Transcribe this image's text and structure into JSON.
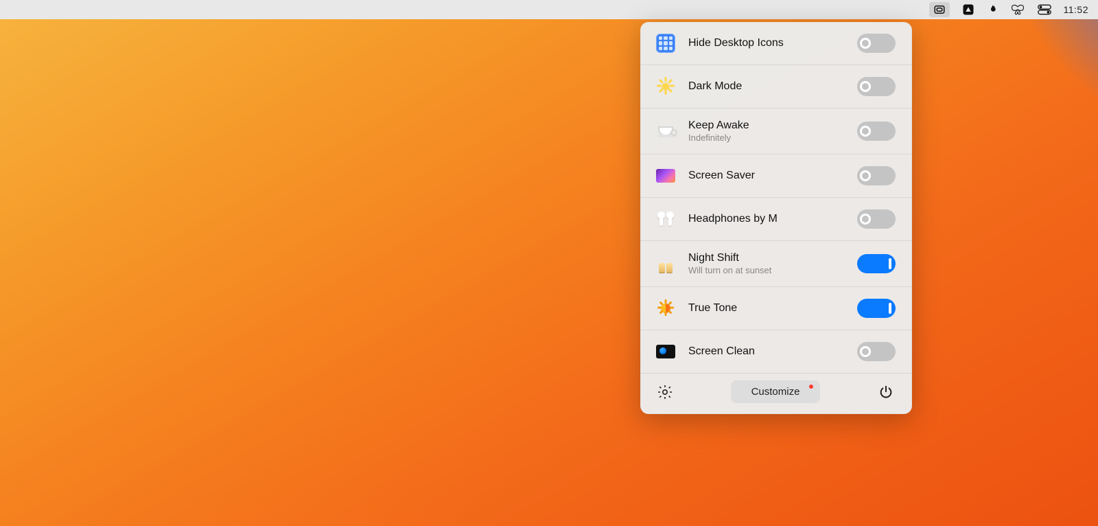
{
  "menubar": {
    "time": "11:52"
  },
  "items": [
    {
      "key": "hide-desktop",
      "label": "Hide Desktop Icons",
      "sub": "",
      "on": false
    },
    {
      "key": "dark-mode",
      "label": "Dark Mode",
      "sub": "",
      "on": false
    },
    {
      "key": "keep-awake",
      "label": "Keep Awake",
      "sub": "Indefinitely",
      "on": false
    },
    {
      "key": "screen-saver",
      "label": "Screen Saver",
      "sub": "",
      "on": false
    },
    {
      "key": "headphones",
      "label": "Headphones by M",
      "sub": "",
      "on": false
    },
    {
      "key": "night-shift",
      "label": "Night Shift",
      "sub": "Will turn on at sunset",
      "on": true
    },
    {
      "key": "true-tone",
      "label": "True Tone",
      "sub": "",
      "on": true
    },
    {
      "key": "screen-clean",
      "label": "Screen Clean",
      "sub": "",
      "on": false
    }
  ],
  "footer": {
    "customize_label": "Customize"
  }
}
